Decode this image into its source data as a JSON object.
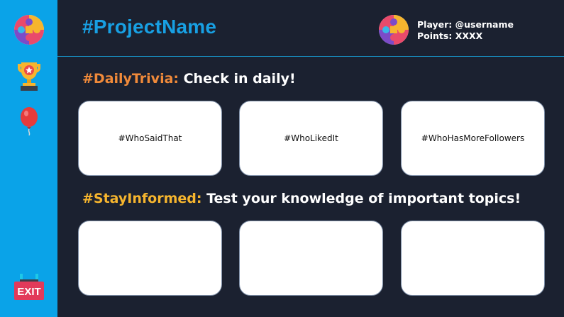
{
  "app": {
    "project_name": "#ProjectName"
  },
  "sidebar": {
    "items": [
      {
        "icon": "puzzle-icon"
      },
      {
        "icon": "trophy-icon"
      },
      {
        "icon": "balloon-icon"
      },
      {
        "icon": "exit-icon",
        "label": "EXIT"
      }
    ]
  },
  "player": {
    "name_line": "Player: @username",
    "points_line": "Points: XXXX"
  },
  "daily_trivia": {
    "tag": "#DailyTrivia:",
    "text": " Check in daily!",
    "cards": [
      {
        "label": "#WhoSaidThat"
      },
      {
        "label": "#WhoLikedIt"
      },
      {
        "label": "#WhoHasMoreFollowers"
      }
    ]
  },
  "stay_informed": {
    "tag": "#StayInformed:",
    "text": " Test your knowledge of important topics!",
    "cards": [
      {
        "label": ""
      },
      {
        "label": ""
      },
      {
        "label": ""
      }
    ]
  },
  "colors": {
    "background": "#1b2130",
    "sidebar": "#0aa3e8",
    "accent_blue": "#18a0e3",
    "accent_orange": "#f08a3a",
    "accent_yellow": "#f6b52e",
    "exit_red": "#e23a5a"
  }
}
